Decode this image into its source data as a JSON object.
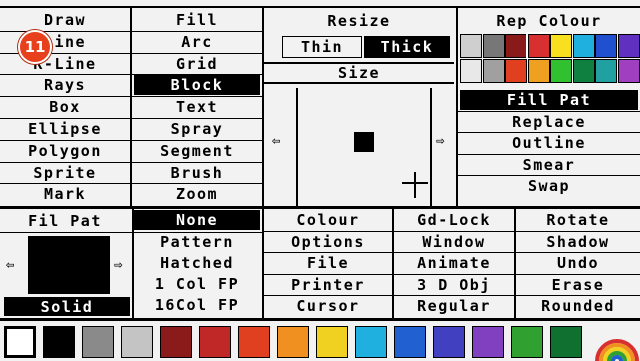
{
  "draw_menu": [
    "Draw",
    "Line",
    "K-Line",
    "Rays",
    "Box",
    "Ellipse",
    "Polygon",
    "Sprite",
    "Mark"
  ],
  "fill_menu": [
    "Fill",
    "Arc",
    "Grid",
    "Block",
    "Text",
    "Spray",
    "Segment",
    "Brush",
    "Zoom"
  ],
  "resize": {
    "title": "Resize",
    "thin": "Thin",
    "thick": "Thick",
    "size": "Size"
  },
  "rep_colour": {
    "title": "Rep Colour",
    "swatches_row1": [
      "#cfcfcf",
      "#777777",
      "#8a1a1a",
      "#d83030",
      "#f8e020",
      "#20b0e0",
      "#2050d0",
      "#6030c0"
    ],
    "swatches_row2": [
      "#e8e8e8",
      "#a0a0a0",
      "#e04020",
      "#f0a020",
      "#30c030",
      "#108040",
      "#20a0a0",
      "#a040c0"
    ],
    "items": [
      "Fill Pat",
      "Replace",
      "Outline",
      "Smear",
      "Swap"
    ]
  },
  "fil_pat": {
    "title": "Fil Pat",
    "none": "None",
    "pattern": "Pattern",
    "hatched": "Hatched",
    "col1": "1 Col FP",
    "col16": "16Col FP",
    "solid": "Solid"
  },
  "menu_grid": [
    [
      "Colour",
      "Gd-Lock",
      "Rotate"
    ],
    [
      "Options",
      "Window",
      "Shadow"
    ],
    [
      "File",
      "Animate",
      "Undo"
    ],
    [
      "Printer",
      "3 D Obj",
      "Erase"
    ],
    [
      "Cursor",
      "Regular",
      "Rounded"
    ]
  ],
  "palette": [
    "#ffffff",
    "#000000",
    "#8a8a8a",
    "#c4c4c4",
    "#8b1a1a",
    "#c02828",
    "#e04020",
    "#f09020",
    "#f0d020",
    "#20b0e0",
    "#2060d0",
    "#4040c0",
    "#8040c0",
    "#30a030",
    "#107030"
  ],
  "badge": "11"
}
